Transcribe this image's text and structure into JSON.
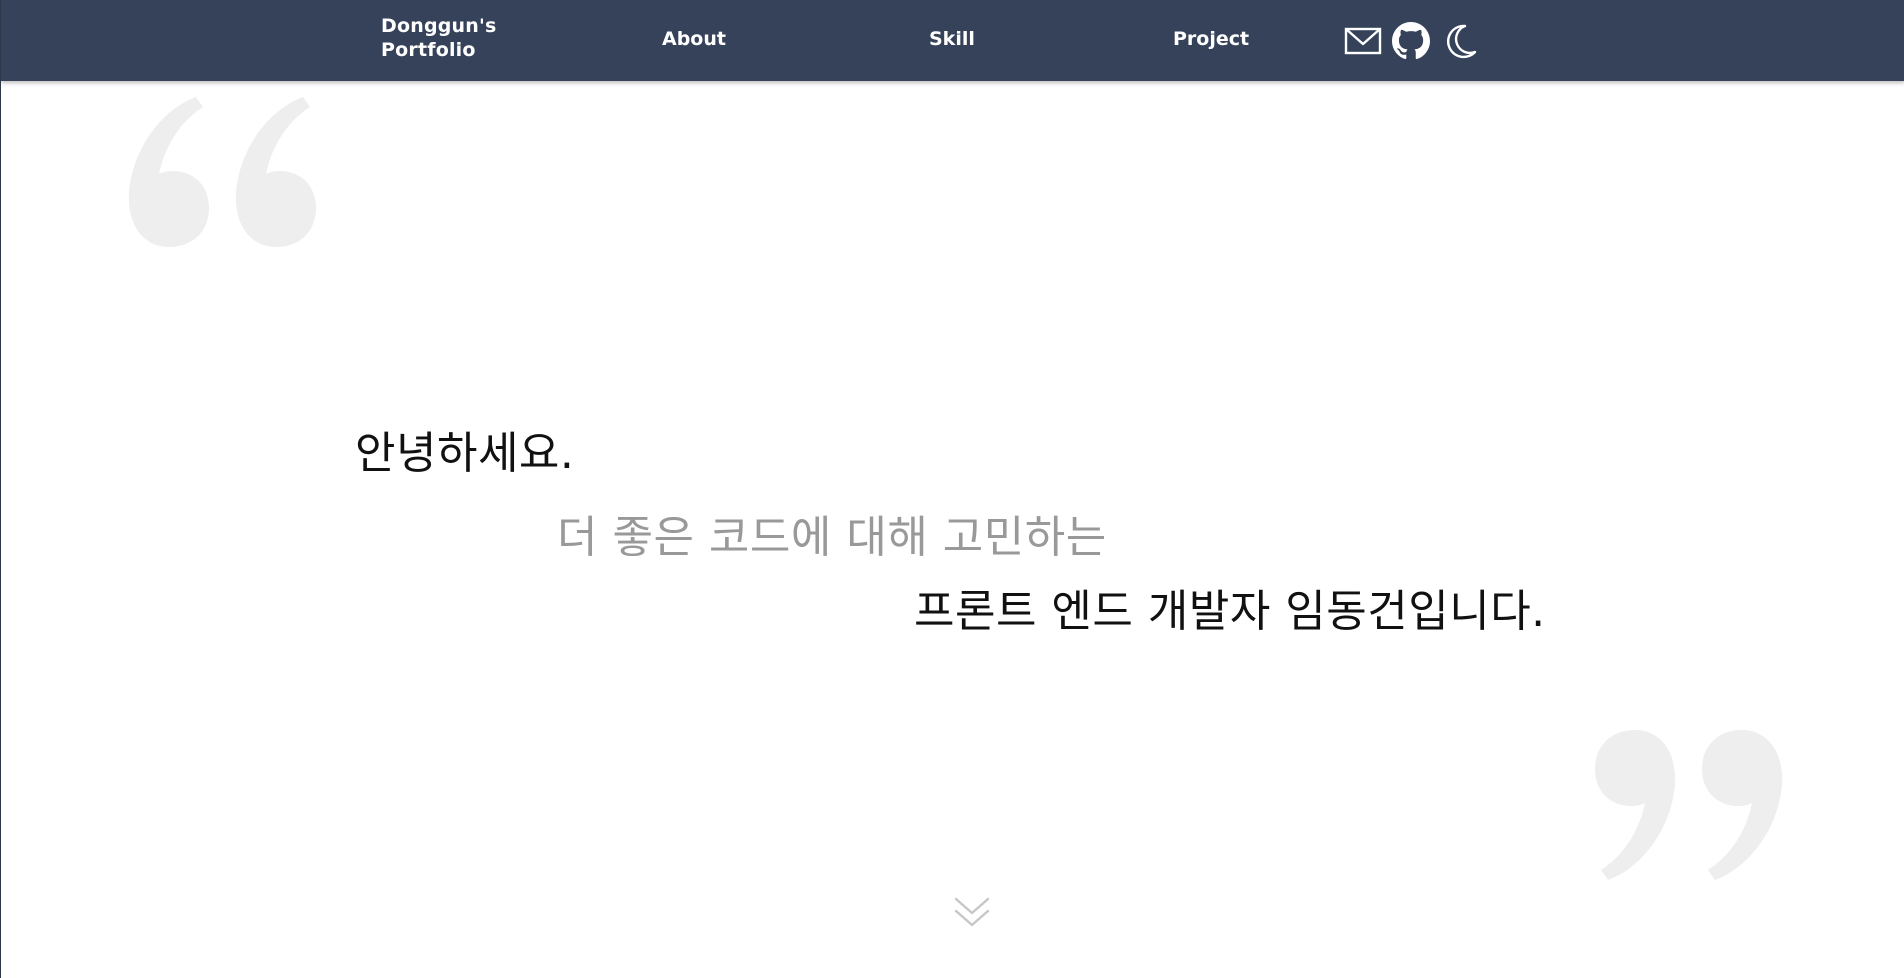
{
  "header": {
    "logo_line1": "Donggun's",
    "logo_line2": "Portfolio",
    "nav": {
      "about": "About",
      "skill": "Skill",
      "project": "Project"
    },
    "icons": [
      "mail-icon",
      "github-icon",
      "moon-icon"
    ]
  },
  "hero": {
    "line1": "안녕하세요.",
    "line2": "더 좋은 코드에 대해 고민하는",
    "line3": "프론트 엔드 개발자 임동건입니다.",
    "scroll_icon": "chevron-double-down-icon"
  },
  "colors": {
    "header_bg": "#36425a",
    "quote_mark": "#eeeeee",
    "text_primary": "#111111",
    "text_muted": "#999999"
  }
}
